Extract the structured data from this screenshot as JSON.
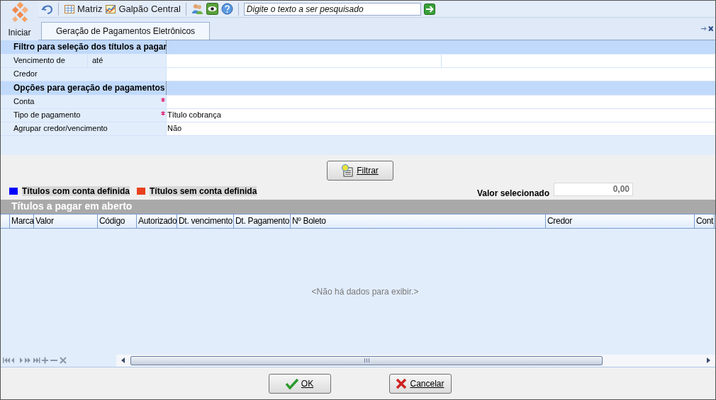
{
  "toolbar": {
    "items": [
      {
        "kind": "undo"
      },
      {
        "kind": "grid",
        "label": "Matriz"
      },
      {
        "kind": "chart",
        "label": "Galpão Central"
      },
      {
        "kind": "users"
      },
      {
        "kind": "eye"
      },
      {
        "kind": "help"
      }
    ],
    "search": {
      "placeholder": "Digite o texto a ser pesquisado"
    }
  },
  "tabs": [
    {
      "label": "Iniciar",
      "selected": false
    },
    {
      "label": "Geração de Pagamentos Eletrônicos",
      "selected": true
    }
  ],
  "form": [
    {
      "kind": "section",
      "label": "Filtro para seleção dos títulos a pagar"
    },
    {
      "kind": "range",
      "label": "Vencimento de",
      "label_2": "até"
    },
    {
      "kind": "field",
      "label": "Credor",
      "required": false
    },
    {
      "kind": "section",
      "label": "Opções para geração de pagamentos"
    },
    {
      "kind": "field",
      "label": "Conta",
      "required": true
    },
    {
      "kind": "field",
      "label": "Tipo de pagamento",
      "required": true,
      "value": "Título cobrança"
    },
    {
      "kind": "field",
      "label": "Agrupar credor/vencimento",
      "required": false,
      "value": "Não"
    }
  ],
  "filter_button": {
    "label": "Filtrar"
  },
  "legend": [
    {
      "label": "Títulos com conta definida",
      "color": "#0000ff"
    },
    {
      "label": "Títulos sem conta definida",
      "color": "#e8401c"
    }
  ],
  "selected_value": {
    "label": "Valor selecionado",
    "value": "0,00"
  },
  "grid": {
    "title": "Títulos a pagar em aberto",
    "columns": [
      "Marca",
      "Valor",
      "Código",
      "Autorizado",
      "Dt. vencimento",
      "Dt. Pagamento",
      "Nº Boleto",
      "Credor",
      "Cont"
    ],
    "empty_message": "<Não há dados para exibir.>"
  },
  "buttons": [
    {
      "kind": "ok",
      "label": "OK"
    },
    {
      "kind": "cancel",
      "label": "Cancelar"
    }
  ]
}
